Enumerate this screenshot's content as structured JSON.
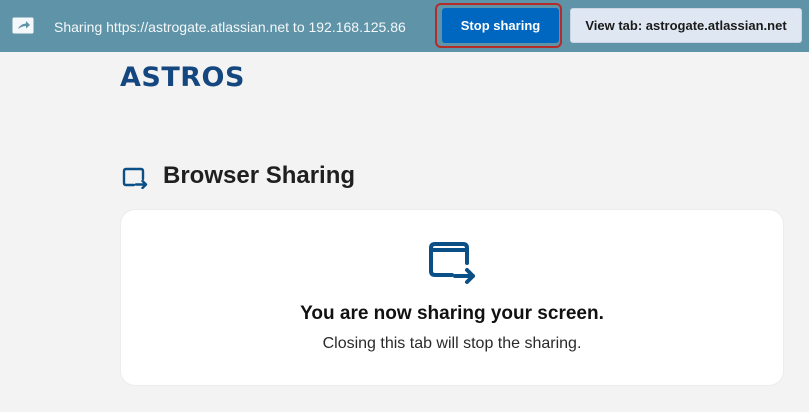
{
  "topbar": {
    "icon": "screen-share-icon",
    "sharing_text": "Sharing https://astrogate.atlassian.net to 192.168.125.86",
    "stop_label": "Stop sharing",
    "view_label": "View tab: astrogate.atlassian.net",
    "background_color": "#5f93a7",
    "stop_color": "#0067c0",
    "highlight_color": "#b52b27"
  },
  "logo": {
    "text": "ASTROS",
    "color": "#14467f"
  },
  "section": {
    "icon": "browser-share-icon",
    "title": "Browser Sharing"
  },
  "card": {
    "icon": "browser-share-icon",
    "heading": "You are now sharing your screen.",
    "subtext": "Closing this tab will stop the sharing.",
    "icon_color": "#0a4f86"
  }
}
